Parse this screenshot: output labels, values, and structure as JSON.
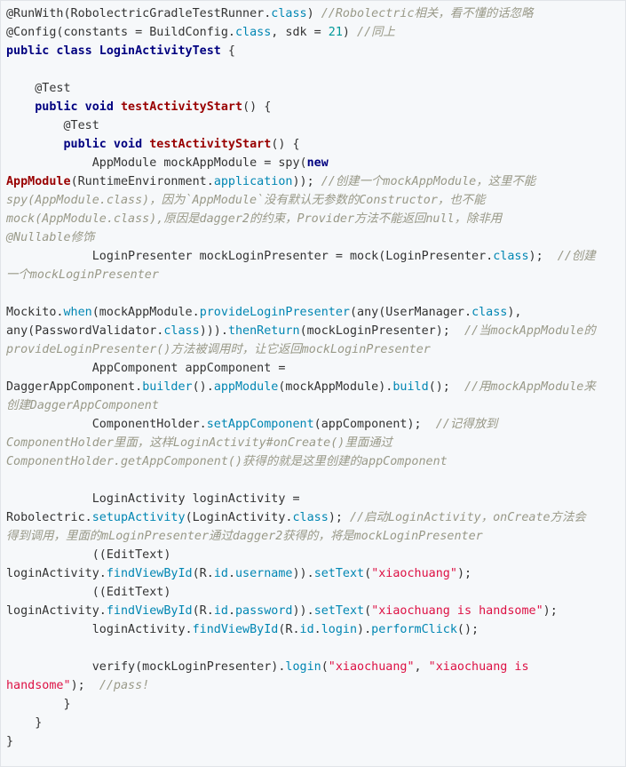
{
  "code": {
    "language": "java",
    "lines": [
      [
        {
          "t": "@RunWith(RobolectricGradleTestRunner.",
          "c": ""
        },
        {
          "t": "class",
          "c": "met"
        },
        {
          "t": ") ",
          "c": ""
        },
        {
          "t": "//Robolectric相关，看不懂的话忽略",
          "c": "cm"
        }
      ],
      [
        {
          "t": "@Config(constants = BuildConfig.",
          "c": ""
        },
        {
          "t": "class",
          "c": "met"
        },
        {
          "t": ", sdk = ",
          "c": ""
        },
        {
          "t": "21",
          "c": "num"
        },
        {
          "t": ") ",
          "c": ""
        },
        {
          "t": "//同上",
          "c": "cm"
        }
      ],
      [
        {
          "t": "public class LoginActivityTest",
          "c": "kw"
        },
        {
          "t": " {",
          "c": ""
        }
      ],
      [],
      [
        {
          "t": "    @Test",
          "c": ""
        }
      ],
      [
        {
          "t": "    ",
          "c": ""
        },
        {
          "t": "public void",
          "c": "kw"
        },
        {
          "t": " ",
          "c": ""
        },
        {
          "t": "testActivityStart",
          "c": "fn"
        },
        {
          "t": "() {",
          "c": ""
        }
      ],
      [
        {
          "t": "        @Test",
          "c": ""
        }
      ],
      [
        {
          "t": "        ",
          "c": ""
        },
        {
          "t": "public void",
          "c": "kw"
        },
        {
          "t": " ",
          "c": ""
        },
        {
          "t": "testActivityStart",
          "c": "fn"
        },
        {
          "t": "() {",
          "c": ""
        }
      ],
      [
        {
          "t": "            AppModule mockAppModule = spy(",
          "c": ""
        },
        {
          "t": "new",
          "c": "kw"
        }
      ],
      [
        {
          "t": "AppModule",
          "c": "fn"
        },
        {
          "t": "(RuntimeEnvironment.",
          "c": ""
        },
        {
          "t": "application",
          "c": "met"
        },
        {
          "t": ")); ",
          "c": ""
        },
        {
          "t": "//创建一个mockAppModule，这里不能",
          "c": "cm"
        }
      ],
      [
        {
          "t": "spy(AppModule.class)，因为`AppModule`没有默认无参数的Constructor，也不能",
          "c": "cm"
        }
      ],
      [
        {
          "t": "mock(AppModule.class),原因是dagger2的约束，Provider方法不能返回null，除非用",
          "c": "cm"
        }
      ],
      [
        {
          "t": "@Nullable修饰",
          "c": "cm"
        }
      ],
      [
        {
          "t": "            LoginPresenter mockLoginPresenter = mock(LoginPresenter.",
          "c": ""
        },
        {
          "t": "class",
          "c": "met"
        },
        {
          "t": ");  ",
          "c": ""
        },
        {
          "t": "//创建",
          "c": "cm"
        }
      ],
      [
        {
          "t": "一个mockLoginPresenter",
          "c": "cm"
        }
      ],
      [],
      [
        {
          "t": "Mockito.",
          "c": ""
        },
        {
          "t": "when",
          "c": "met"
        },
        {
          "t": "(mockAppModule.",
          "c": ""
        },
        {
          "t": "provideLoginPresenter",
          "c": "met"
        },
        {
          "t": "(any(UserManager.",
          "c": ""
        },
        {
          "t": "class",
          "c": "met"
        },
        {
          "t": "),",
          "c": ""
        }
      ],
      [
        {
          "t": "any(PasswordValidator.",
          "c": ""
        },
        {
          "t": "class",
          "c": "met"
        },
        {
          "t": "))).",
          "c": ""
        },
        {
          "t": "thenReturn",
          "c": "met"
        },
        {
          "t": "(mockLoginPresenter);  ",
          "c": ""
        },
        {
          "t": "//当mockAppModule的",
          "c": "cm"
        }
      ],
      [
        {
          "t": "provideLoginPresenter()方法被调用时，让它返回mockLoginPresenter",
          "c": "cm"
        }
      ],
      [
        {
          "t": "            AppComponent appComponent =",
          "c": ""
        }
      ],
      [
        {
          "t": "DaggerAppComponent.",
          "c": ""
        },
        {
          "t": "builder",
          "c": "met"
        },
        {
          "t": "().",
          "c": ""
        },
        {
          "t": "appModule",
          "c": "met"
        },
        {
          "t": "(mockAppModule).",
          "c": ""
        },
        {
          "t": "build",
          "c": "met"
        },
        {
          "t": "();  ",
          "c": ""
        },
        {
          "t": "//用mockAppModule来",
          "c": "cm"
        }
      ],
      [
        {
          "t": "创建DaggerAppComponent",
          "c": "cm"
        }
      ],
      [
        {
          "t": "            ComponentHolder.",
          "c": ""
        },
        {
          "t": "setAppComponent",
          "c": "met"
        },
        {
          "t": "(appComponent);  ",
          "c": ""
        },
        {
          "t": "//记得放到",
          "c": "cm"
        }
      ],
      [
        {
          "t": "ComponentHolder里面，这样LoginActivity#onCreate()里面通过",
          "c": "cm"
        }
      ],
      [
        {
          "t": "ComponentHolder.getAppComponent()获得的就是这里创建的appComponent",
          "c": "cm"
        }
      ],
      [],
      [
        {
          "t": "            LoginActivity loginActivity =",
          "c": ""
        }
      ],
      [
        {
          "t": "Robolectric.",
          "c": ""
        },
        {
          "t": "setupActivity",
          "c": "met"
        },
        {
          "t": "(LoginActivity.",
          "c": ""
        },
        {
          "t": "class",
          "c": "met"
        },
        {
          "t": "); ",
          "c": ""
        },
        {
          "t": "//启动LoginActivity，onCreate方法会",
          "c": "cm"
        }
      ],
      [
        {
          "t": "得到调用，里面的mLoginPresenter通过dagger2获得的，将是mockLoginPresenter",
          "c": "cm"
        }
      ],
      [
        {
          "t": "            ((EditText)",
          "c": ""
        }
      ],
      [
        {
          "t": "loginActivity.",
          "c": ""
        },
        {
          "t": "findViewById",
          "c": "met"
        },
        {
          "t": "(R.",
          "c": ""
        },
        {
          "t": "id",
          "c": "met"
        },
        {
          "t": ".",
          "c": ""
        },
        {
          "t": "username",
          "c": "met"
        },
        {
          "t": ")).",
          "c": ""
        },
        {
          "t": "setText",
          "c": "met"
        },
        {
          "t": "(",
          "c": ""
        },
        {
          "t": "\"xiaochuang\"",
          "c": "str"
        },
        {
          "t": ");",
          "c": ""
        }
      ],
      [
        {
          "t": "            ((EditText)",
          "c": ""
        }
      ],
      [
        {
          "t": "loginActivity.",
          "c": ""
        },
        {
          "t": "findViewById",
          "c": "met"
        },
        {
          "t": "(R.",
          "c": ""
        },
        {
          "t": "id",
          "c": "met"
        },
        {
          "t": ".",
          "c": ""
        },
        {
          "t": "password",
          "c": "met"
        },
        {
          "t": ")).",
          "c": ""
        },
        {
          "t": "setText",
          "c": "met"
        },
        {
          "t": "(",
          "c": ""
        },
        {
          "t": "\"xiaochuang is handsome\"",
          "c": "str"
        },
        {
          "t": ");",
          "c": ""
        }
      ],
      [
        {
          "t": "            loginActivity.",
          "c": ""
        },
        {
          "t": "findViewById",
          "c": "met"
        },
        {
          "t": "(R.",
          "c": ""
        },
        {
          "t": "id",
          "c": "met"
        },
        {
          "t": ".",
          "c": ""
        },
        {
          "t": "login",
          "c": "met"
        },
        {
          "t": ").",
          "c": ""
        },
        {
          "t": "performClick",
          "c": "met"
        },
        {
          "t": "();",
          "c": ""
        }
      ],
      [],
      [
        {
          "t": "            verify(mockLoginPresenter).",
          "c": ""
        },
        {
          "t": "login",
          "c": "met"
        },
        {
          "t": "(",
          "c": ""
        },
        {
          "t": "\"xiaochuang\"",
          "c": "str"
        },
        {
          "t": ", ",
          "c": ""
        },
        {
          "t": "\"xiaochuang is",
          "c": "str"
        }
      ],
      [
        {
          "t": "handsome\"",
          "c": "str"
        },
        {
          "t": ");  ",
          "c": ""
        },
        {
          "t": "//pass!",
          "c": "cm"
        }
      ],
      [
        {
          "t": "        }",
          "c": ""
        }
      ],
      [
        {
          "t": "    }",
          "c": ""
        }
      ],
      [
        {
          "t": "}",
          "c": ""
        }
      ]
    ]
  }
}
